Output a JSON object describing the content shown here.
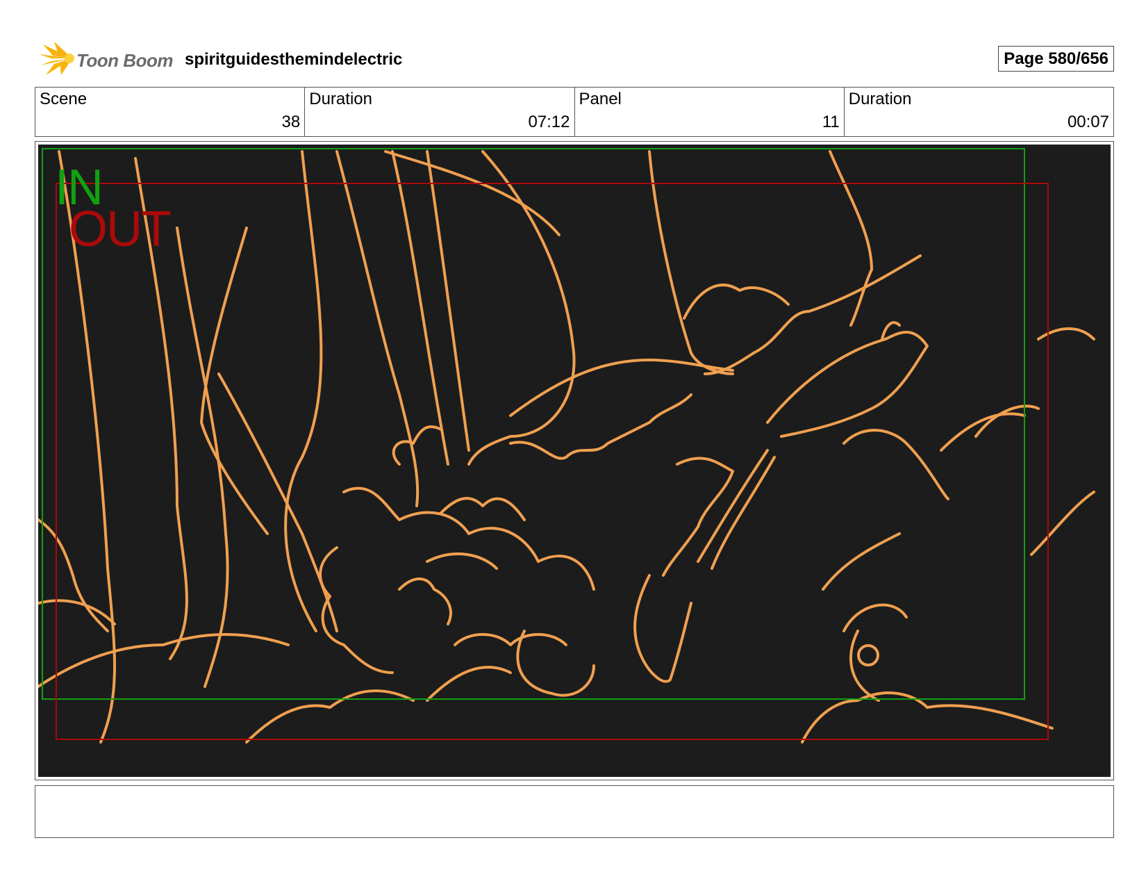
{
  "header": {
    "logo_text": "Toon Boom",
    "project_title": "spiritguidesthemindelectric",
    "page_label": "Page 580/656"
  },
  "info": {
    "scene_label": "Scene",
    "scene_value": "38",
    "scene_duration_label": "Duration",
    "scene_duration_value": "07:12",
    "panel_label": "Panel",
    "panel_value": "11",
    "panel_duration_label": "Duration",
    "panel_duration_value": "00:07"
  },
  "panel": {
    "field_in_label": "IN",
    "field_out_label": "OUT",
    "background_color": "#1c1c1c",
    "line_color": "#f0a050",
    "in_frame_color": "#12a012",
    "out_frame_color": "#aa0a0a"
  },
  "notes": {
    "text": ""
  }
}
